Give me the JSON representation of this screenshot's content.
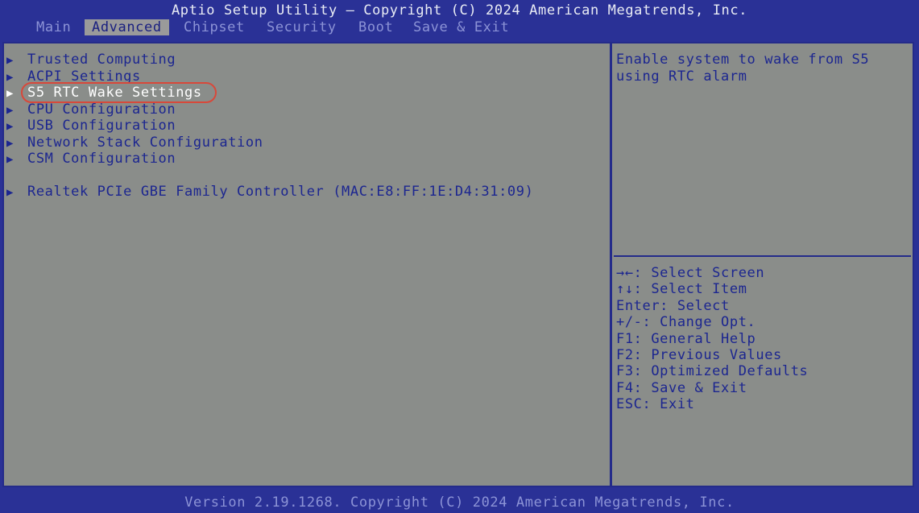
{
  "header": {
    "title": "Aptio Setup Utility – Copyright (C) 2024 American Megatrends, Inc."
  },
  "tabs": [
    {
      "label": "Main",
      "active": false
    },
    {
      "label": "Advanced",
      "active": true
    },
    {
      "label": "Chipset",
      "active": false
    },
    {
      "label": "Security",
      "active": false
    },
    {
      "label": "Boot",
      "active": false
    },
    {
      "label": "Save & Exit",
      "active": false
    }
  ],
  "menu": {
    "arrow_glyph": "▶",
    "selected_index": 2,
    "items": [
      {
        "label": "Trusted Computing"
      },
      {
        "label": "ACPI Settings"
      },
      {
        "label": "S5 RTC Wake Settings"
      },
      {
        "label": "CPU Configuration"
      },
      {
        "label": "USB Configuration"
      },
      {
        "label": "Network Stack Configuration"
      },
      {
        "label": "CSM Configuration"
      },
      {
        "label": "Realtek PCIe GBE Family Controller (MAC:E8:FF:1E:D4:31:09)"
      }
    ]
  },
  "help": {
    "line1": "Enable system to wake from S5",
    "line2": "using RTC alarm"
  },
  "keys": [
    "→←: Select Screen",
    "↑↓: Select Item",
    "Enter: Select",
    "+/-: Change Opt.",
    "F1: General Help",
    "F2: Previous Values",
    "F3: Optimized Defaults",
    "F4: Save & Exit",
    "ESC: Exit"
  ],
  "footer": {
    "version": "Version 2.19.1268. Copyright (C) 2024 American Megatrends, Inc."
  },
  "colors": {
    "frame_blue": "#2a3196",
    "panel_gray": "#8a8d8a",
    "text_blue": "#1c2690",
    "selected_text": "#ffffff",
    "annotation_red": "#d8483a"
  }
}
